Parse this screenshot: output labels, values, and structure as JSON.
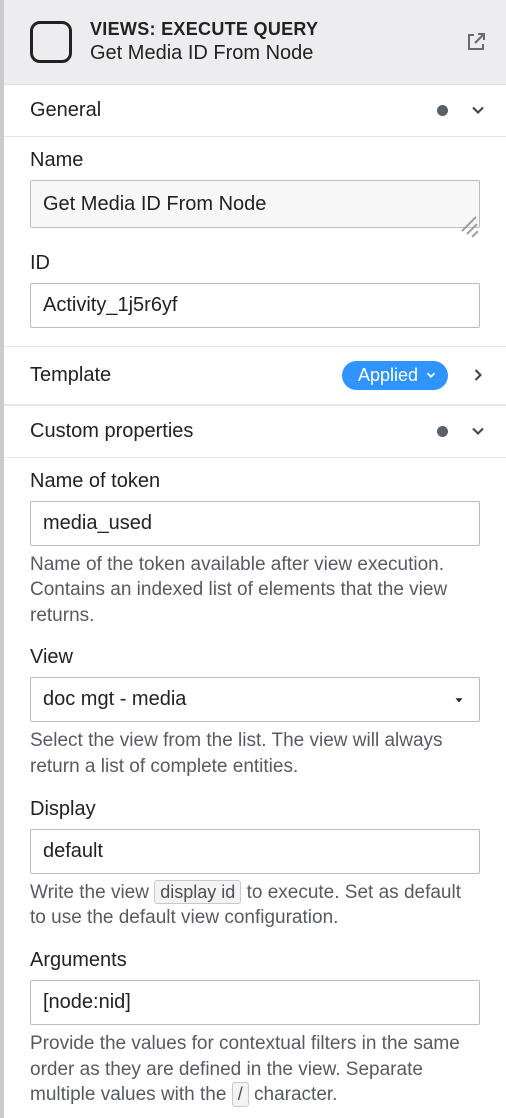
{
  "header": {
    "overline": "VIEWS: EXECUTE QUERY",
    "subtitle": "Get Media ID From Node"
  },
  "sections": {
    "general": {
      "title": "General"
    },
    "template": {
      "title": "Template",
      "badge": "Applied"
    },
    "custom": {
      "title": "Custom properties"
    }
  },
  "general": {
    "name_label": "Name",
    "name_value": "Get Media ID From Node",
    "id_label": "ID",
    "id_value": "Activity_1j5r6yf"
  },
  "custom": {
    "token_label": "Name of token",
    "token_value": "media_used",
    "token_help": "Name of the token available after view execution. Contains an indexed list of elements that the view returns.",
    "view_label": "View",
    "view_value": "doc mgt - media",
    "view_help": "Select the view from the list. The view will always return a list of complete entities.",
    "display_label": "Display",
    "display_value": "default",
    "display_help_pre": "Write the view ",
    "display_help_kbd": "display id",
    "display_help_post": " to execute. Set as default to use the default view configuration.",
    "args_label": "Arguments",
    "args_value": "[node:nid]",
    "args_help_pre": "Provide the values for contextual filters in the same order as they are defined in the view. Separate multiple values with the ",
    "args_help_kbd": "/",
    "args_help_post": " character."
  }
}
